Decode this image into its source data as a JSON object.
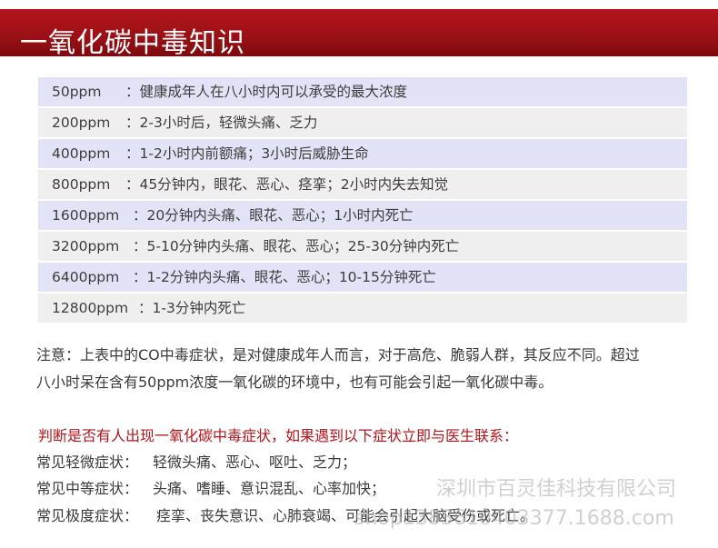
{
  "title": "一氧化碳中毒知识",
  "rows": [
    {
      "ppm": "50ppm",
      "desc": "：健康成年人在八小时内可以承受的最大浓度"
    },
    {
      "ppm": "200ppm",
      "desc": "：2-3小时后，轻微头痛、乏力"
    },
    {
      "ppm": "400ppm",
      "desc": "：1-2小时内前额痛；3小时后威胁生命"
    },
    {
      "ppm": "800ppm",
      "desc": "：45分钟内，眼花、恶心、痉挛；2小时内失去知觉"
    },
    {
      "ppm": "1600ppm",
      "desc": "：20分钟内头痛、眼花、恶心；1小时内死亡"
    },
    {
      "ppm": "3200ppm",
      "desc": "：5-10分钟内头痛、眼花、恶心；25-30分钟内死亡"
    },
    {
      "ppm": "6400ppm",
      "desc": "：1-2分钟内头痛、眼花、恶心；10-15分钟死亡"
    },
    {
      "ppm": "12800ppm",
      "desc": "：1-3分钟内死亡"
    }
  ],
  "note": {
    "line1": "注意：上表中的CO中毒症状，是对健康成年人而言，对于高危、脆弱人群，其反应不同。超过",
    "line2": "八小时呆在含有50ppm浓度一氧化碳的环境中，也有可能会引起一氧化碳中毒。"
  },
  "warning": "判断是否有人出现一氧化碳中毒症状，如果遇到以下症状立即与医生联系：",
  "symptoms": [
    {
      "label": "常见轻微症状：",
      "value": "轻微头痛、恶心、呕吐、乏力；"
    },
    {
      "label": "常见中等症状：",
      "value": "头痛、嗜睡、意识混乱、心率加快；"
    },
    {
      "label": "常见极度症状：",
      "value": "痉挛、丧失意识、心肺衰竭、可能会引起大脑受伤或死亡。"
    }
  ],
  "watermark": {
    "line1": "深圳市百灵佳科技有限公司",
    "line2": "shop1383610403377.1688.com"
  },
  "colors": {
    "banner": "#9c1116",
    "row_odd": "#e3e3f7",
    "row_even": "#efefef",
    "warning": "#b0151b"
  }
}
